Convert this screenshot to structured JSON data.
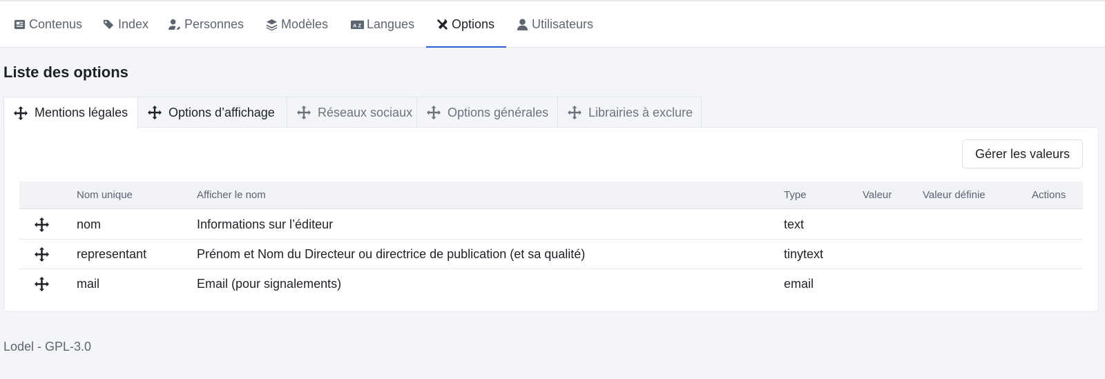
{
  "nav": {
    "items": [
      {
        "label": "Contenus",
        "icon": "newspaper-icon"
      },
      {
        "label": "Index",
        "icon": "tags-icon"
      },
      {
        "label": "Personnes",
        "icon": "user-pen-icon"
      },
      {
        "label": "Modèles",
        "icon": "layers-icon"
      },
      {
        "label": "Langues",
        "icon": "language-icon"
      },
      {
        "label": "Options",
        "icon": "tools-icon",
        "active": true
      },
      {
        "label": "Utilisateurs",
        "icon": "user-icon"
      }
    ]
  },
  "page": {
    "title": "Liste des options"
  },
  "tabs": [
    {
      "label": "Mentions légales",
      "active": true
    },
    {
      "label": "Options d’affichage"
    },
    {
      "label": "Réseaux sociaux"
    },
    {
      "label": "Options générales"
    },
    {
      "label": "Librairies à exclure"
    }
  ],
  "toolbar": {
    "manage_label": "Gérer les valeurs"
  },
  "table": {
    "headers": [
      "Nom unique",
      "Afficher le nom",
      "Type",
      "Valeur",
      "Valeur définie",
      "Actions"
    ],
    "rows": [
      {
        "name": "nom",
        "display": "Informations sur l’éditeur",
        "type": "text",
        "value": "",
        "defined": "",
        "actions": ""
      },
      {
        "name": "representant",
        "display": "Prénom et Nom du Directeur ou directrice de publication (et sa qualité)",
        "type": "tinytext",
        "value": "",
        "defined": "",
        "actions": ""
      },
      {
        "name": "mail",
        "display": "Email (pour signalements)",
        "type": "email",
        "value": "",
        "defined": "",
        "actions": ""
      }
    ]
  },
  "footer": {
    "text": "Lodel - GPL-3.0"
  },
  "colors": {
    "accent": "#2f5bd9",
    "background": "#f4f5f8",
    "text": "#1d2127",
    "muted": "#5c6470"
  }
}
